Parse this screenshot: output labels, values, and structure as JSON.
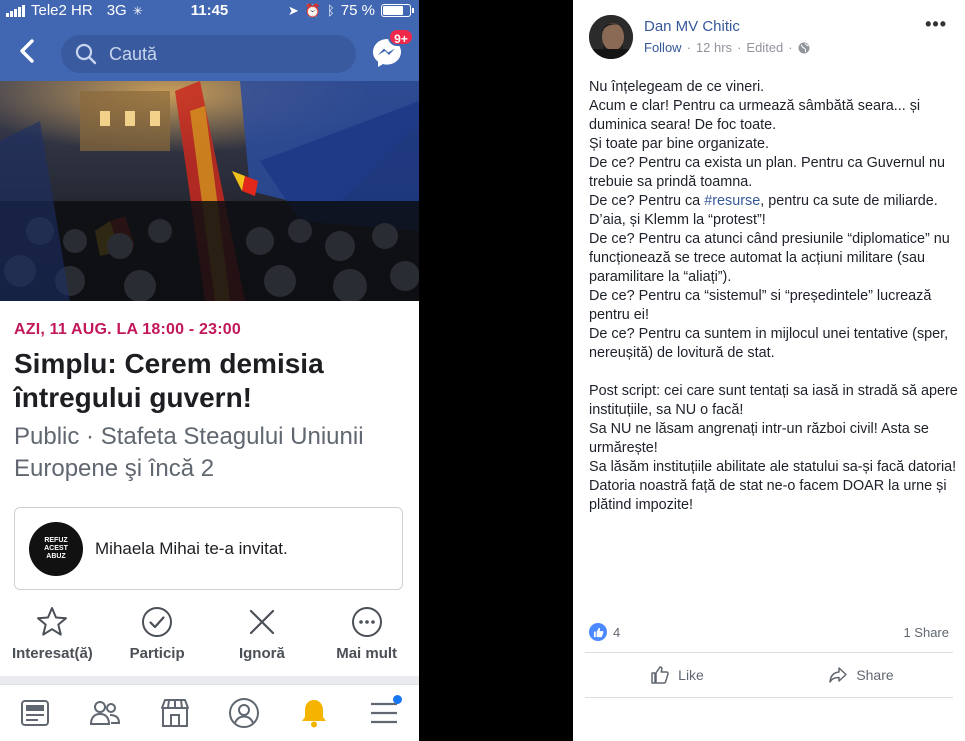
{
  "status_bar": {
    "carrier": "Tele2 HR",
    "network": "3G",
    "time": "11:45",
    "battery": "75 %"
  },
  "search": {
    "placeholder": "Caută"
  },
  "messenger": {
    "badge": "9+"
  },
  "event": {
    "date": "AZI, 11 AUG. LA 18:00 - 23:00",
    "title": "Simplu: Cerem demisia întregului guvern!",
    "meta": "Public · Stafeta Steagului Uniunii Europene şi încă 2",
    "invite_avatar_text": "REFUZ ACEST ABUZ",
    "invite_text": "Mihaela Mihai te-a invitat.",
    "actions": [
      {
        "label": "Interesat(ă)",
        "icon": "star-icon"
      },
      {
        "label": "Particip",
        "icon": "check-circle-icon"
      },
      {
        "label": "Ignoră",
        "icon": "close-icon"
      },
      {
        "label": "Mai mult",
        "icon": "more-circle-icon"
      }
    ]
  },
  "tabbar": [
    "news-feed-icon",
    "friends-icon",
    "marketplace-icon",
    "profile-icon",
    "notifications-bell-icon",
    "menu-icon"
  ],
  "colors": {
    "facebook_blue": "#4267b2",
    "event_date": "#c2185b",
    "link": "#365899",
    "badge_red": "#f02849",
    "bell_yellow": "#f5b400"
  },
  "post": {
    "author": "Dan MV Chitic",
    "follow": "Follow",
    "time": "12 hrs",
    "edited": "Edited",
    "body": [
      "Nu înțelegeam de ce vineri.",
      "Acum e clar! Pentru ca urmează sâmbătă seara... și duminica seara! De foc toate.",
      "Și toate par bine organizate.",
      "De ce? Pentru ca exista un plan. Pentru ca Guvernul nu trebuie sa prindă toamna.",
      "De ce? Pentru ca ",
      "#resurse",
      ", pentru ca sute de miliarde. D’aia, și Klemm la “protest”!",
      "De ce? Pentru ca atunci când presiunile “diplomatice” nu funcționează se trece automat la acțiuni militare (sau paramilitare la “aliați”).",
      "De ce? Pentru ca “sistemul” si “președintele” lucrează pentru ei!",
      "De ce? Pentru ca suntem in mijlocul unei tentative (sper, nereușită) de lovitură de stat.",
      "",
      "Post script: cei care sunt tentați sa iasă in stradă să apere instituțiile, sa NU o facă!",
      "Sa NU ne lăsam angrenați intr-un război civil! Asta se urmărește!",
      "Sa lăsăm instituțiile abilitate ale statului sa-și facă datoria!",
      "Datoria noastră față de stat ne-o facem DOAR la urne și plătind impozite!"
    ],
    "like_count": "4",
    "share_count": "1 Share",
    "like_label": "Like",
    "share_label": "Share"
  }
}
